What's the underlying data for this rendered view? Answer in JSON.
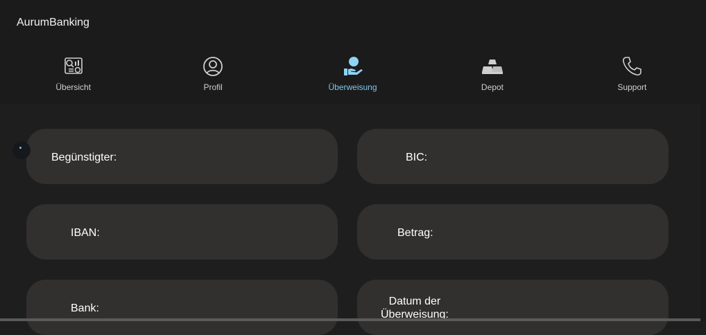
{
  "app": {
    "title": "AurumBanking"
  },
  "tabs": [
    {
      "label": "Übersicht",
      "icon": "dashboard-icon",
      "active": false
    },
    {
      "label": "Profil",
      "icon": "person-circle-icon",
      "active": false
    },
    {
      "label": "Überweisung",
      "icon": "hand-coin-icon",
      "active": true
    },
    {
      "label": "Depot",
      "icon": "gold-bars-icon",
      "active": false
    },
    {
      "label": "Support",
      "icon": "phone-icon",
      "active": false
    }
  ],
  "form": {
    "beneficiary_label": "Begünstigter:",
    "bic_label": "BIC:",
    "iban_label": "IBAN:",
    "amount_label": "Betrag:",
    "bank_label": "Bank:",
    "date_label_line1": "Datum der",
    "date_label_line2": "Überweisung:"
  },
  "colors": {
    "background": "#1e1e1e",
    "field": "#322f2f",
    "accent": "#8fd3f5"
  }
}
